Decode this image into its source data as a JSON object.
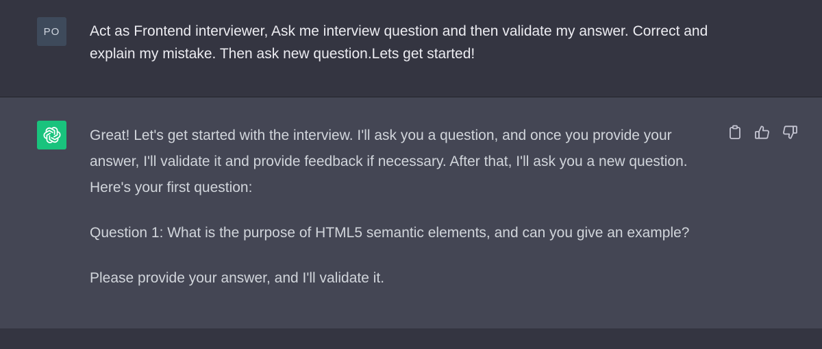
{
  "user": {
    "avatar_initials": "PO",
    "message": "Act as Frontend interviewer, Ask me interview question and then validate my answer. Correct and explain my mistake. Then ask new question.Lets get started!"
  },
  "assistant": {
    "avatar_icon": "openai-logo-icon",
    "paragraphs": [
      "Great! Let's get started with the interview. I'll ask you a question, and once you provide your answer, I'll validate it and provide feedback if necessary. After that, I'll ask you a new question. Here's your first question:",
      "Question 1: What is the purpose of HTML5 semantic elements, and can you give an example?",
      "Please provide your answer, and I'll validate it."
    ],
    "actions": [
      {
        "name": "copy-icon"
      },
      {
        "name": "thumbs-up-icon"
      },
      {
        "name": "thumbs-down-icon"
      }
    ]
  },
  "colors": {
    "user_bg": "#343541",
    "assistant_bg": "#444654",
    "assistant_avatar": "#19c37d",
    "user_avatar": "#3e4a5b"
  }
}
